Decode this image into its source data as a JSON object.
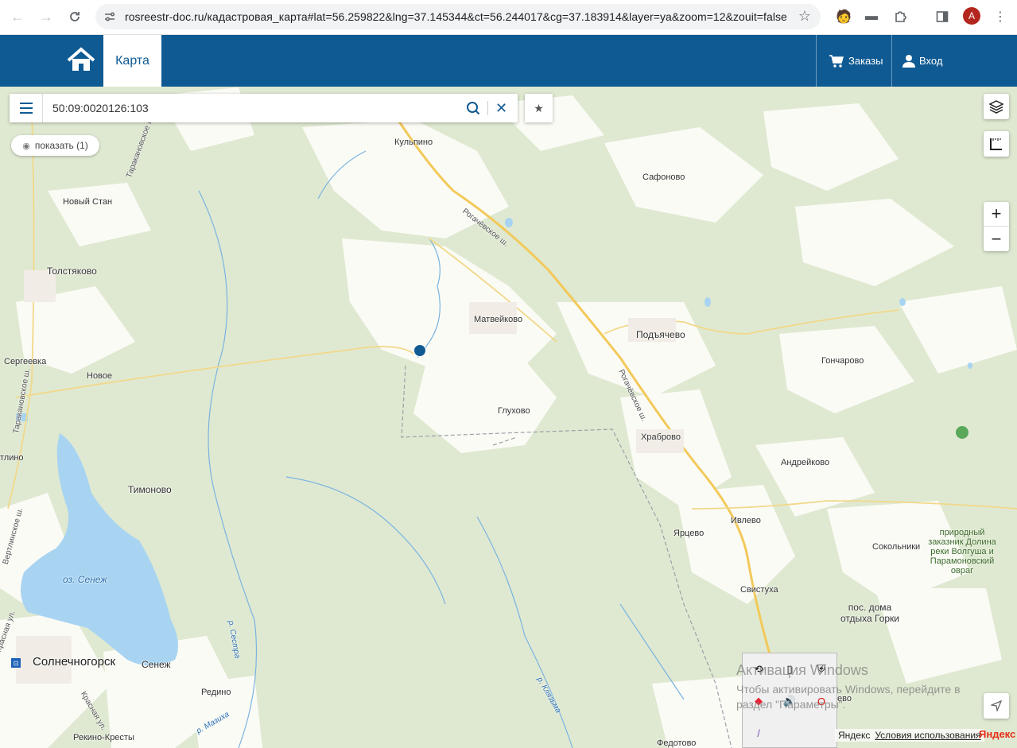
{
  "browser": {
    "url": "rosreestr-doc.ru/кадастровая_карта#lat=56.259822&lng=37.145344&ct=56.244017&cg=37.183914&layer=ya&zoom=12&zouit=false",
    "avatar_letter": "A"
  },
  "header": {
    "home_icon": "home-icon",
    "tab_map": "Карта",
    "orders": "Заказы",
    "login": "Вход"
  },
  "search": {
    "value": "50:09:0020126:103",
    "show_button": "показать (1)"
  },
  "map": {
    "labels": {
      "kulpino": "Кульпино",
      "safonovo": "Сафоново",
      "novy_stan": "Новый Стан",
      "tolstyakovo": "Толстяково",
      "matveykovo": "Матвейково",
      "podyachevo": "Подъячево",
      "goncharovo": "Гончарово",
      "sergeevka": "Сергеевка",
      "novoe": "Новое",
      "glukhovo": "Глухово",
      "khrabrovo": "Храброво",
      "andreykovo": "Андрейково",
      "tlino": "тлино",
      "timonovo": "Тимоново",
      "yartsevo": "Ярцево",
      "ivlevo": "Ивлево",
      "sokolniki": "Сокольники",
      "svistukha": "Свистуха",
      "gorki": "пос. дома отдыха Горки",
      "senezh_lake": "оз. Сенеж",
      "solnechnogorsk": "Солнечногорск",
      "senezh": "Сенеж",
      "redino": "Редино",
      "rekino": "Рекино-Кресты",
      "fedotovo": "Федотово",
      "reserve": "природный заказник Долина реки Волгуша и Парамоновский овраг",
      "rogachevskoe1": "Рогачёвское ш.",
      "rogachevskoe2": "Рогачёвское ш.",
      "sestra": "р. Сестра",
      "klyazma": "р. Клязьма",
      "mazikha": "р. Мазиха",
      "krasnaya1": "Красная ул.",
      "krasnaya2": "Красная ул.",
      "tarakanovskoe1": "Тараканов­ское ш.",
      "tarakanovskoe2": "Тараканов­ское ш.",
      "vertlinskoe": "Вертлинское ш.",
      "eevo": "ево"
    },
    "copyright": "Яндекс",
    "terms": "Условия использования",
    "logo": "Яндекс"
  },
  "watermark": {
    "line1": "Активация Windows",
    "line2": "Чтобы активировать Windows, перейдите в раздел \"Параметры\"."
  },
  "colors": {
    "brand": "#0f5a93",
    "marker": "#0f5a93",
    "forest": "#dfe9d1",
    "field": "#fbfbf7",
    "water": "#a8d4f2",
    "road": "#f2c95a"
  }
}
